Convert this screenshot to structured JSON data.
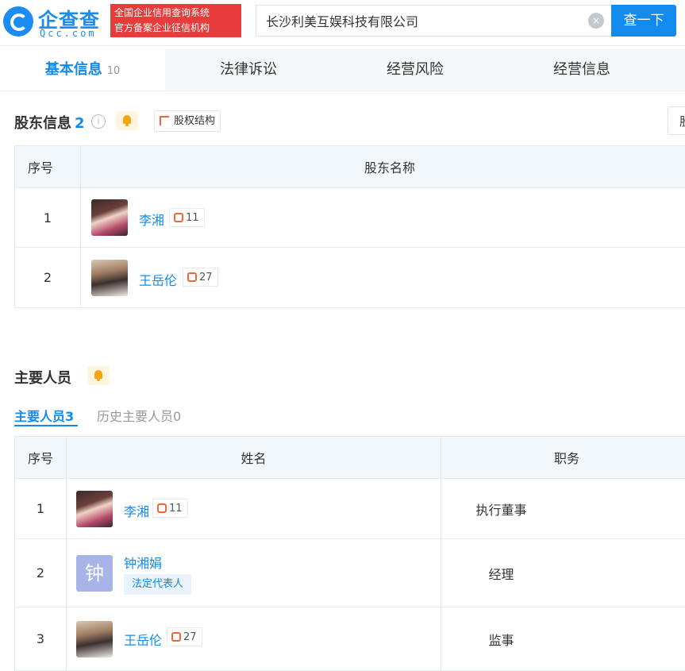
{
  "header": {
    "logo_cn": "企查查",
    "logo_en": "Qcc.com",
    "badge_line1": "全国企业信用查询系统",
    "badge_line2": "官方备案企业征信机构",
    "search_value": "长沙利美互娱科技有限公司",
    "clear_icon": "×",
    "search_button": "查一下"
  },
  "tabs": [
    {
      "label": "基本信息",
      "count": "10"
    },
    {
      "label": "法律诉讼"
    },
    {
      "label": "经营风险"
    },
    {
      "label": "经营信息"
    }
  ],
  "shareholders": {
    "title": "股东信息",
    "count": "2",
    "info_icon": "i",
    "equity_button": "股权结构",
    "right_button": "股",
    "columns": {
      "index": "序号",
      "name": "股东名称"
    },
    "rows": [
      {
        "index": "1",
        "name": "李湘",
        "relations": "11"
      },
      {
        "index": "2",
        "name": "王岳伦",
        "relations": "27"
      }
    ]
  },
  "personnel": {
    "title": "主要人员",
    "subtab_active_label": "主要人员",
    "subtab_active_count": "3",
    "subtab_history_label": "历史主要人员",
    "subtab_history_count": "0",
    "columns": {
      "index": "序号",
      "name": "姓名",
      "role": "职务"
    },
    "rows": [
      {
        "index": "1",
        "name": "李湘",
        "relations": "11",
        "role": "执行董事"
      },
      {
        "index": "2",
        "name": "钟湘娟",
        "avatar_char": "钟",
        "tag": "法定代表人",
        "role": "经理"
      },
      {
        "index": "3",
        "name": "王岳伦",
        "relations": "27",
        "role": "监事"
      }
    ]
  }
}
